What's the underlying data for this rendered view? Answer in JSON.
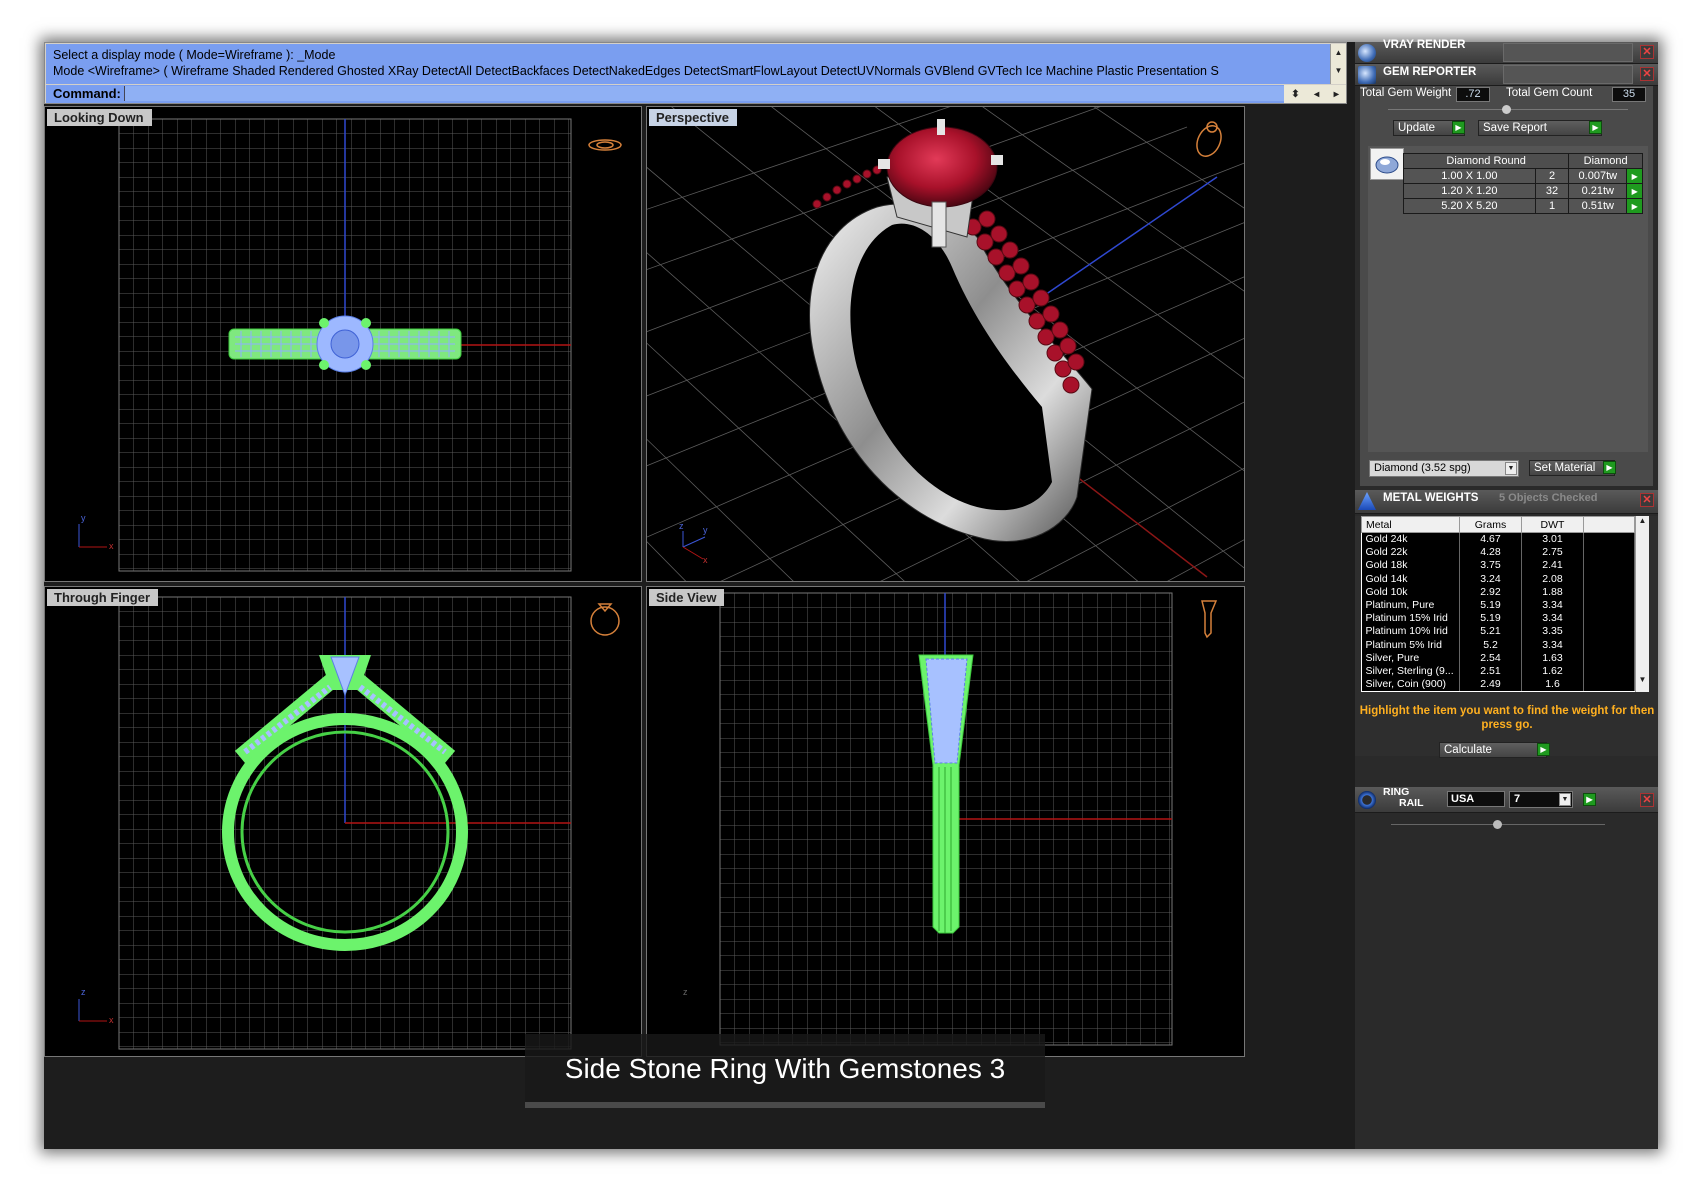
{
  "command_area": {
    "history_line1": "Select a display mode ( Mode=Wireframe ): _Mode",
    "history_line2": "Mode <Wireframe> ( Wireframe  Shaded  Rendered  Ghosted  XRay  DetectAll  DetectBackfaces  DetectNakedEdges  DetectSmartFlowLayout  DetectUVNormals  GVBlend  GVTech  Ice  Machine  Plastic  Presentation  S",
    "prompt_label": "Command:"
  },
  "viewports": {
    "top_left": {
      "title": "Looking Down",
      "axis1": "y",
      "axis2": "x"
    },
    "top_right": {
      "title": "Perspective",
      "axis1": "z",
      "axis2": "y",
      "axis3": "x"
    },
    "bottom_left": {
      "title": "Through Finger",
      "axis1": "z",
      "axis2": "x"
    },
    "bottom_right": {
      "title": "Side View",
      "axis1": "z"
    }
  },
  "caption": "Side Stone Ring With Gemstones 3",
  "colors": {
    "wire_green": "#6cf36c",
    "wire_blue": "#8fb0ff",
    "command_blue": "#7a9ef0",
    "ruby": "#a8112a",
    "hint_orange": "#ffb020"
  },
  "panel": {
    "vray": {
      "title": "VRAY RENDER"
    },
    "gem_reporter": {
      "title": "GEM REPORTER",
      "total_weight_label": "Total Gem Weight",
      "total_weight_value": ".72",
      "total_count_label": "Total Gem Count",
      "total_count_value": "35",
      "update_label": "Update",
      "save_report_label": "Save Report",
      "col_shape": "Diamond Round",
      "col_material": "Diamond",
      "rows": [
        {
          "size": "1.00 X 1.00",
          "count": "2",
          "weight": "0.007tw"
        },
        {
          "size": "1.20 X 1.20",
          "count": "32",
          "weight": "0.21tw"
        },
        {
          "size": "5.20 X 5.20",
          "count": "1",
          "weight": "0.51tw"
        }
      ],
      "material_select": "Diamond     (3.52 spg)",
      "set_material_label": "Set Material"
    },
    "metal_weights": {
      "title": "METAL WEIGHTS",
      "status": "5 Objects Checked",
      "headers": [
        "Metal",
        "Grams",
        "DWT"
      ],
      "rows": [
        [
          "Gold 24k",
          "4.67",
          "3.01"
        ],
        [
          "Gold 22k",
          "4.28",
          "2.75"
        ],
        [
          "Gold 18k",
          "3.75",
          "2.41"
        ],
        [
          "Gold 14k",
          "3.24",
          "2.08"
        ],
        [
          "Gold 10k",
          "2.92",
          "1.88"
        ],
        [
          "Platinum, Pure",
          "5.19",
          "3.34"
        ],
        [
          "Platinum 15% Irid",
          "5.19",
          "3.34"
        ],
        [
          "Platinum 10% Irid",
          "5.21",
          "3.35"
        ],
        [
          "Platinum 5% Irid",
          "5.2",
          "3.34"
        ],
        [
          "Silver, Pure",
          "2.54",
          "1.63"
        ],
        [
          "Silver, Sterling (9...",
          "2.51",
          "1.62"
        ],
        [
          "Silver, Coin (900)",
          "2.49",
          "1.6"
        ]
      ],
      "hint": "Highlight the item you want to find the weight for then press go.",
      "calculate_label": "Calculate"
    },
    "ring_rail": {
      "title_line1": "RING",
      "title_line2": "RAIL",
      "standard": "USA",
      "size": "7"
    }
  }
}
